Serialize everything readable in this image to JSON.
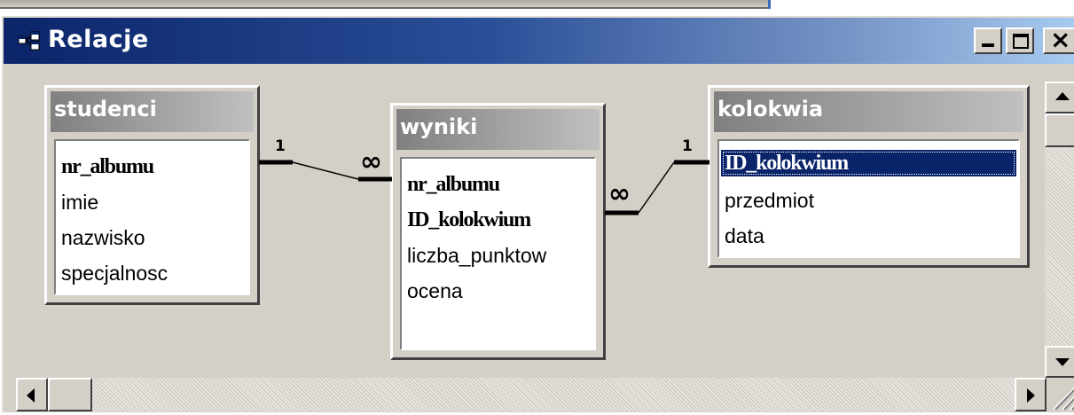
{
  "window": {
    "title": "Relacje",
    "title_icon": "relationships-icon"
  },
  "tables": [
    {
      "name": "studenci",
      "fields": [
        {
          "label": "nr_albumu",
          "key": true
        },
        {
          "label": "imie",
          "key": false
        },
        {
          "label": "nazwisko",
          "key": false
        },
        {
          "label": "specjalnosc",
          "key": false
        }
      ]
    },
    {
      "name": "wyniki",
      "fields": [
        {
          "label": "nr_albumu",
          "key": true
        },
        {
          "label": "ID_kolokwium",
          "key": true
        },
        {
          "label": "liczba_punktow",
          "key": false
        },
        {
          "label": "ocena",
          "key": false
        }
      ]
    },
    {
      "name": "kolokwia",
      "fields": [
        {
          "label": "ID_kolokwium",
          "key": true,
          "selected": true
        },
        {
          "label": "przedmiot",
          "key": false
        },
        {
          "label": "data",
          "key": false
        }
      ]
    }
  ],
  "relationships": [
    {
      "from": "studenci.nr_albumu",
      "to": "wyniki.nr_albumu",
      "one_label": "1",
      "many_label": "∞"
    },
    {
      "from": "kolokwia.ID_kolokwium",
      "to": "wyniki.ID_kolokwium",
      "one_label": "1",
      "many_label": "∞"
    }
  ],
  "colors": {
    "title_gradient_start": "#0b246a",
    "title_gradient_end": "#a6caf0",
    "window_bg": "#d4d0c8",
    "selection": "#0a246a"
  }
}
